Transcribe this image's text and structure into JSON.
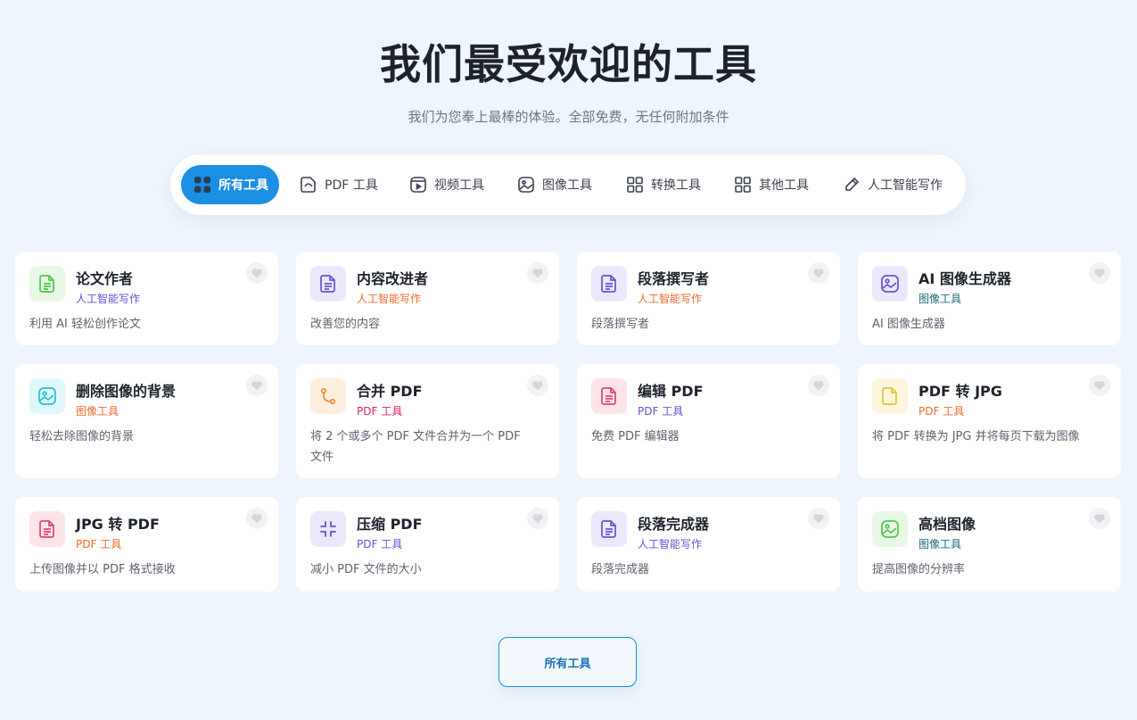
{
  "header": {
    "title": "我们最受欢迎的工具",
    "subtitle": "我们为您奉上最棒的体验。全部免费，无任何附加条件"
  },
  "tabs": [
    {
      "label": "所有工具",
      "icon": "grid-dots-icon",
      "active": true
    },
    {
      "label": "PDF 工具",
      "icon": "pdf-file-icon",
      "active": false
    },
    {
      "label": "视频工具",
      "icon": "video-icon",
      "active": false
    },
    {
      "label": "图像工具",
      "icon": "image-icon",
      "active": false
    },
    {
      "label": "转换工具",
      "icon": "grid-icon",
      "active": false
    },
    {
      "label": "其他工具",
      "icon": "grid-icon",
      "active": false
    },
    {
      "label": "人工智能写作",
      "icon": "pen-icon",
      "active": false
    }
  ],
  "cards": [
    {
      "title": "论文作者",
      "category": "人工智能写作",
      "description": "利用 AI 轻松创作论文",
      "icon": "document-icon",
      "icon_color": "#4cc94c",
      "icon_bg": "#e7f9e5",
      "category_color": "#6a4fd8"
    },
    {
      "title": "内容改进者",
      "category": "人工智能写作",
      "description": "改善您的内容",
      "icon": "document-icon",
      "icon_color": "#6a4fd8",
      "icon_bg": "#ece8fb",
      "category_color": "#ef6a2a"
    },
    {
      "title": "段落撰写者",
      "category": "人工智能写作",
      "description": "段落撰写者",
      "icon": "document-icon",
      "icon_color": "#6a4fd8",
      "icon_bg": "#ece8fb",
      "category_color": "#ef6a2a"
    },
    {
      "title": "AI 图像生成器",
      "category": "图像工具",
      "description": "AI 图像生成器",
      "icon": "image-icon",
      "icon_color": "#6a4fd8",
      "icon_bg": "#ece8fb",
      "category_color": "#1e6a78"
    },
    {
      "title": "删除图像的背景",
      "category": "图像工具",
      "description": "轻松去除图像的背景",
      "icon": "image-icon",
      "icon_color": "#22c3d8",
      "icon_bg": "#e1f8fb",
      "category_color": "#ef6a2a"
    },
    {
      "title": "合并 PDF",
      "category": "PDF 工具",
      "description": "将 2 个或多个 PDF 文件合并为一个 PDF 文件",
      "icon": "merge-icon",
      "icon_color": "#ef8a2a",
      "icon_bg": "#fdeee0",
      "category_color": "#e0245e"
    },
    {
      "title": "编辑 PDF",
      "category": "PDF 工具",
      "description": "免费 PDF 编辑器",
      "icon": "document-icon",
      "icon_color": "#e0456a",
      "icon_bg": "#fde4ea",
      "category_color": "#6a4fd8"
    },
    {
      "title": "PDF 转 JPG",
      "category": "PDF 工具",
      "description": "将 PDF 转换为 JPG 并将每页下载为图像",
      "icon": "file-icon",
      "icon_color": "#e8c23a",
      "icon_bg": "#fdf6dd",
      "category_color": "#ef6a2a"
    },
    {
      "title": "JPG 转 PDF",
      "category": "PDF 工具",
      "description": "上传图像并以 PDF 格式接收",
      "icon": "document-icon",
      "icon_color": "#e0456a",
      "icon_bg": "#fde4ea",
      "category_color": "#ef6a2a"
    },
    {
      "title": "压缩 PDF",
      "category": "PDF 工具",
      "description": "减小 PDF 文件的大小",
      "icon": "compress-icon",
      "icon_color": "#6a4fd8",
      "icon_bg": "#ece8fb",
      "category_color": "#6a4fd8"
    },
    {
      "title": "段落完成器",
      "category": "人工智能写作",
      "description": "段落完成器",
      "icon": "document-icon",
      "icon_color": "#6a4fd8",
      "icon_bg": "#ece8fb",
      "category_color": "#6a4fd8"
    },
    {
      "title": "高档图像",
      "category": "图像工具",
      "description": "提高图像的分辨率",
      "icon": "image-icon",
      "icon_color": "#4cc94c",
      "icon_bg": "#e7f9e5",
      "category_color": "#1e6a78"
    }
  ],
  "footer": {
    "all_tools_label": "所有工具"
  }
}
